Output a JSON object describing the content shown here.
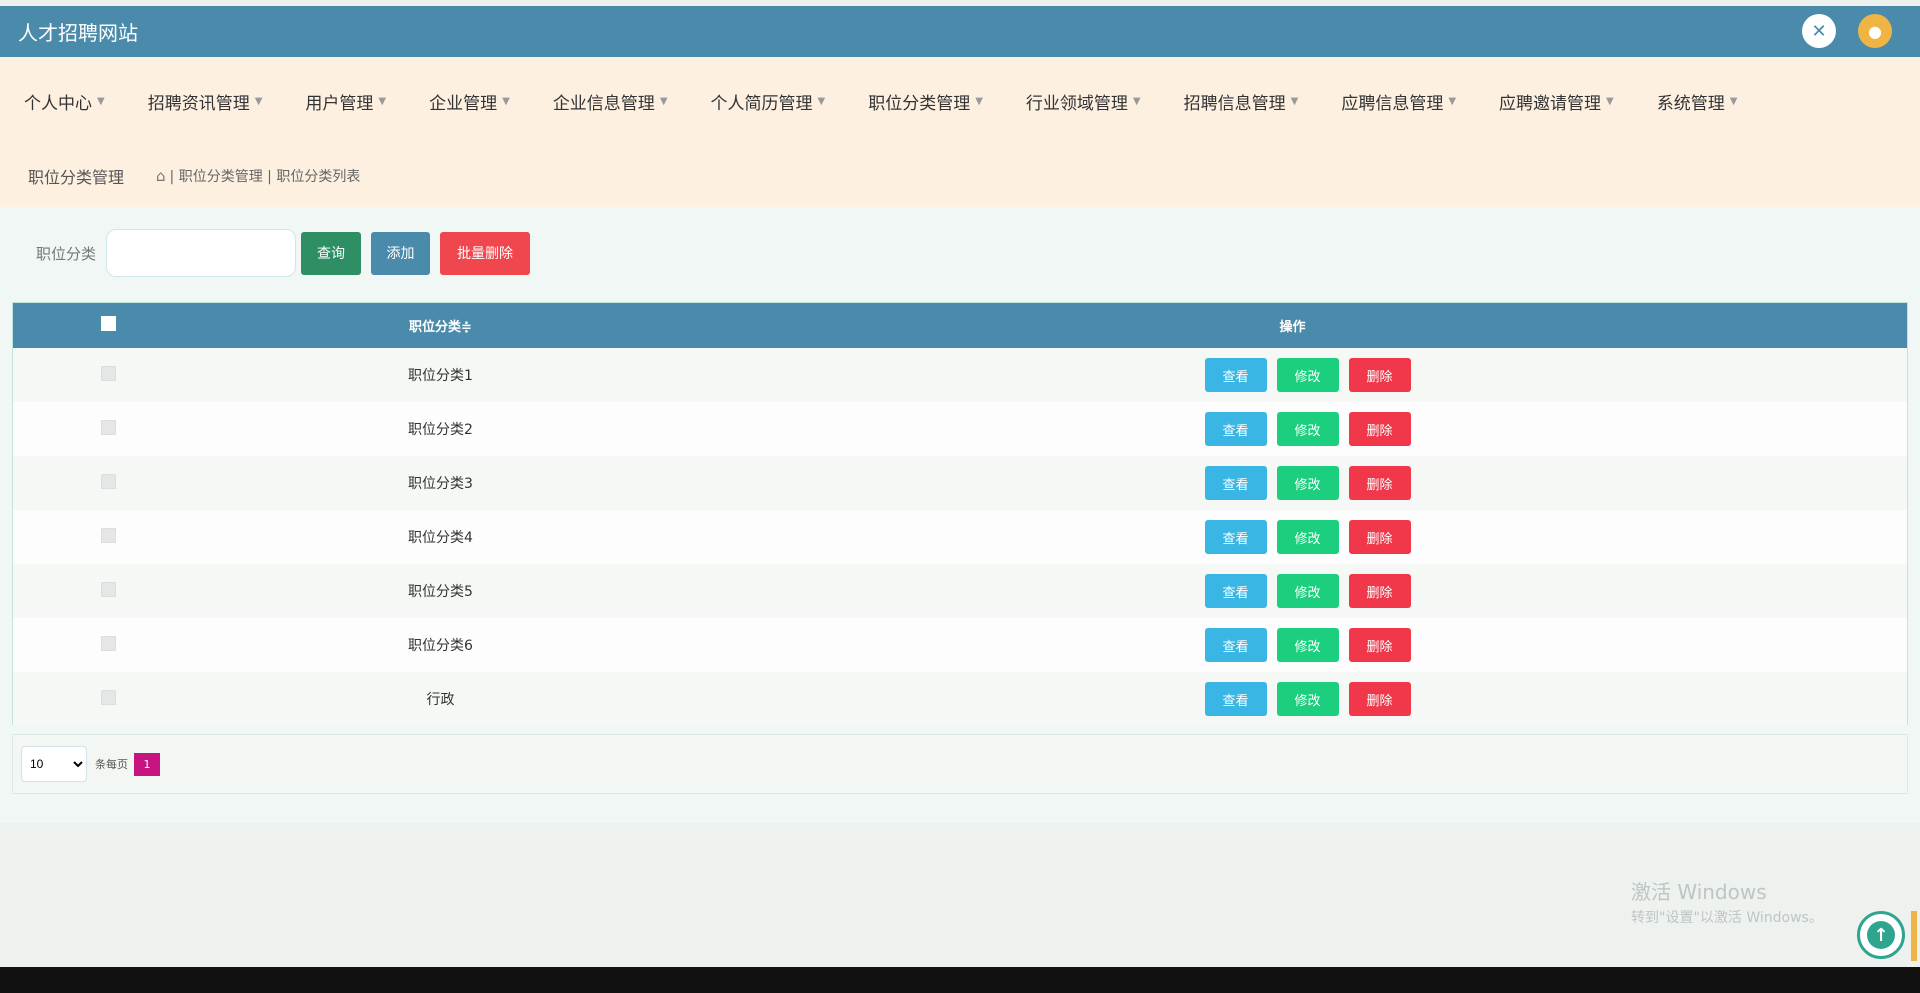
{
  "header": {
    "brand": "人才招聘网站",
    "icons": [
      "fullscreen-icon",
      "user-avatar-icon"
    ]
  },
  "menu": [
    {
      "label": "个人中心"
    },
    {
      "label": "招聘资讯管理"
    },
    {
      "label": "用户管理"
    },
    {
      "label": "企业管理"
    },
    {
      "label": "企业信息管理"
    },
    {
      "label": "个人简历管理"
    },
    {
      "label": "职位分类管理"
    },
    {
      "label": "行业领域管理"
    },
    {
      "label": "招聘信息管理"
    },
    {
      "label": "应聘信息管理"
    },
    {
      "label": "应聘邀请管理"
    },
    {
      "label": "系统管理"
    }
  ],
  "breadcrumb": {
    "title": "职位分类管理",
    "path": "| 职位分类管理 | 职位分类列表"
  },
  "search": {
    "label": "职位分类",
    "value": "",
    "search_button": "查询",
    "add_button": "添加",
    "batch_delete_button": "批量删除"
  },
  "table": {
    "columns": [
      "职位分类≑",
      "操作"
    ],
    "rows": [
      {
        "name": "职位分类1"
      },
      {
        "name": "职位分类2"
      },
      {
        "name": "职位分类3"
      },
      {
        "name": "职位分类4"
      },
      {
        "name": "职位分类5"
      },
      {
        "name": "职位分类6"
      },
      {
        "name": "行政"
      }
    ],
    "actions": {
      "view": "查看",
      "edit": "修改",
      "delete": "删除"
    }
  },
  "pagination": {
    "page_size": "10",
    "page_size_options": [
      "10"
    ],
    "per_page_text": "条每页",
    "current_page": "1"
  },
  "watermark": {
    "line1": "激活 Windows",
    "line2": "转到\"设置\"以激活 Windows。"
  },
  "colors": {
    "header": "#4a8aaa",
    "menu_bg": "#fdf0e1",
    "view": "#3ab6e4",
    "edit": "#1ccf7e",
    "delete": "#f0384a",
    "page_active": "#c6137f"
  }
}
